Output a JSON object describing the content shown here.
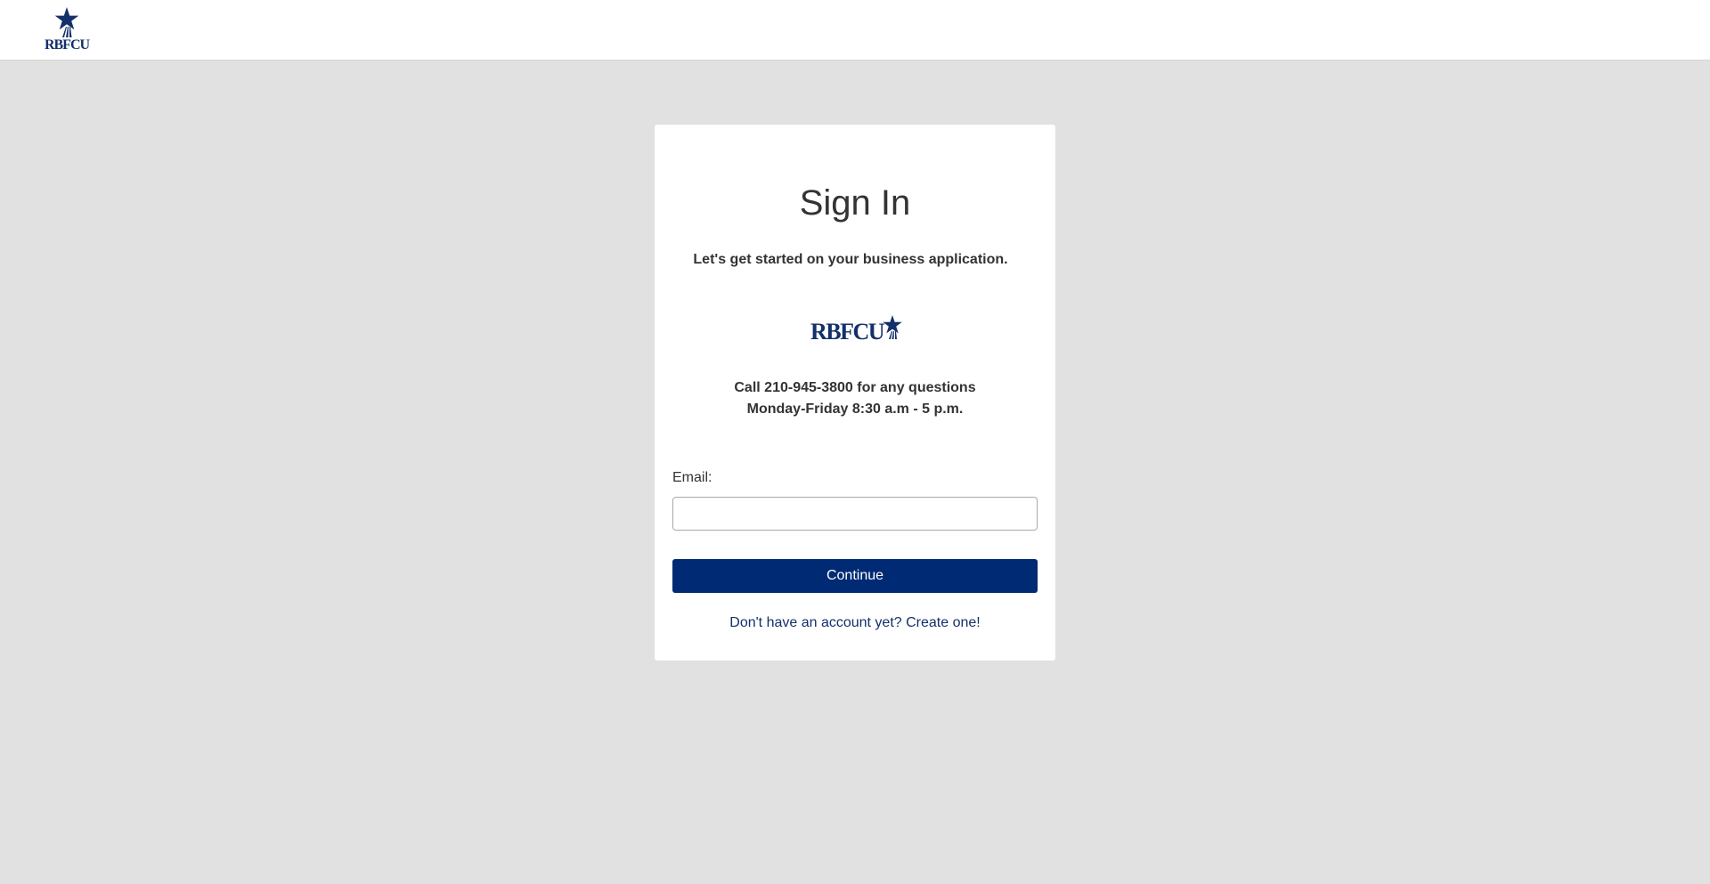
{
  "header": {
    "logo_text": "RBFCU"
  },
  "card": {
    "title": "Sign In",
    "subtitle": "Let's get started on your business application.",
    "logo_text": "RBFCU",
    "contact_line_1": "Call 210-945-3800 for any questions",
    "contact_line_2": "Monday-Friday 8:30 a.m - 5 p.m.",
    "email_label": "Email:",
    "email_value": "",
    "email_placeholder": "",
    "continue_label": "Continue",
    "create_account_link": "Don't have an account yet? Create one!"
  },
  "colors": {
    "brand_navy": "#002a74",
    "logo_navy": "#13306a",
    "page_background": "#e1e1e1",
    "card_background": "#ffffff"
  },
  "icons": {
    "header_logo": "rbfcu-star-logo-icon",
    "card_logo_star": "star-icon"
  }
}
